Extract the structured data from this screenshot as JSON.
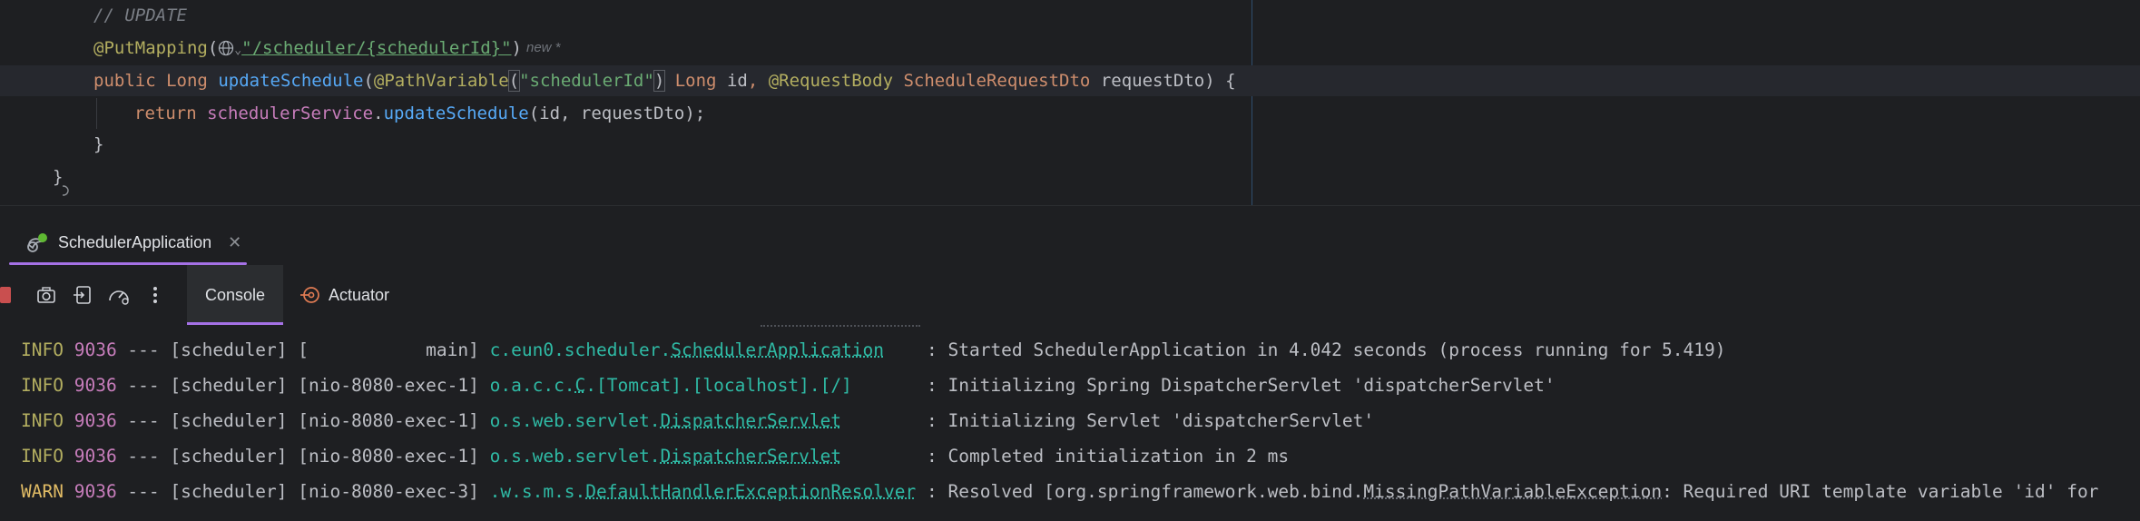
{
  "editor": {
    "comment": "// UPDATE",
    "put_mapping_annotation": "@PutMapping",
    "put_mapping_path": "\"/scheduler/{schedulerId}\"",
    "new_hint": "new *",
    "sig": {
      "public": "public",
      "return_type": "Long",
      "method": "updateSchedule",
      "path_variable": "@PathVariable",
      "path_variable_value": "\"schedulerId\"",
      "long_type": "Long",
      "id_param": "id",
      "request_body": "@RequestBody",
      "dto_type": "ScheduleRequestDto",
      "dto_param": "requestDto",
      "open_brace": "{"
    },
    "return_stmt": {
      "return_kw": "return",
      "service": "schedulerService",
      "call": "updateSchedule",
      "args": "(id, requestDto);"
    },
    "close_inner": "}",
    "close_outer": "}"
  },
  "run_window": {
    "tab_title": "SchedulerApplication",
    "tabs": {
      "console": "Console",
      "actuator": "Actuator"
    }
  },
  "console": {
    "lines": [
      {
        "level": "INFO",
        "pid": "9036",
        "sep": " --- ",
        "app": "[scheduler]",
        "thread": "[           main]",
        "logger_prefix": "c.eun0.scheduler.",
        "logger_class": "SchedulerApplication",
        "logger_pad": "    ",
        "message": ": Started SchedulerApplication in 4.042 seconds (process running for 5.419)"
      },
      {
        "level": "INFO",
        "pid": "9036",
        "sep": " --- ",
        "app": "[scheduler]",
        "thread": "[nio-8080-exec-1]",
        "logger_prefix": "o.a.c.c.",
        "logger_class": "C",
        "logger_suffix": ".[Tomcat].[localhost].[/]",
        "logger_pad": "       ",
        "message": ": Initializing Spring DispatcherServlet 'dispatcherServlet'"
      },
      {
        "level": "INFO",
        "pid": "9036",
        "sep": " --- ",
        "app": "[scheduler]",
        "thread": "[nio-8080-exec-1]",
        "logger_prefix": "o.s.web.servlet.",
        "logger_class": "DispatcherServlet",
        "logger_pad": "        ",
        "message": ": Initializing Servlet 'dispatcherServlet'"
      },
      {
        "level": "INFO",
        "pid": "9036",
        "sep": " --- ",
        "app": "[scheduler]",
        "thread": "[nio-8080-exec-1]",
        "logger_prefix": "o.s.web.servlet.",
        "logger_class": "DispatcherServlet",
        "logger_pad": "        ",
        "message": ": Completed initialization in 2 ms"
      },
      {
        "level": "WARN",
        "pid": "9036",
        "sep": " --- ",
        "app": "[scheduler]",
        "thread": "[nio-8080-exec-3]",
        "logger_prefix": ".w.s.m.s.",
        "logger_class": "DefaultHandlerExceptionResolver",
        "logger_pad": " ",
        "message_prefix": ": Resolved [org.springframework.web.bind.",
        "message_class": "MissingPathVariableException",
        "message_suffix": ": Required URI template variable 'id' for"
      }
    ]
  },
  "colors": {
    "accent": "#a571e6",
    "stop": "#c94f4f",
    "info": "#b3ae60",
    "pid": "#c77dbb",
    "logger": "#2fbaa5"
  },
  "icons": [
    "run-config-icon",
    "close-icon",
    "stop-icon",
    "camera-icon",
    "restore-layout-icon",
    "gauge-icon",
    "more-options-icon",
    "actuator-icon",
    "globe-icon",
    "gutter-mapping-icon"
  ]
}
